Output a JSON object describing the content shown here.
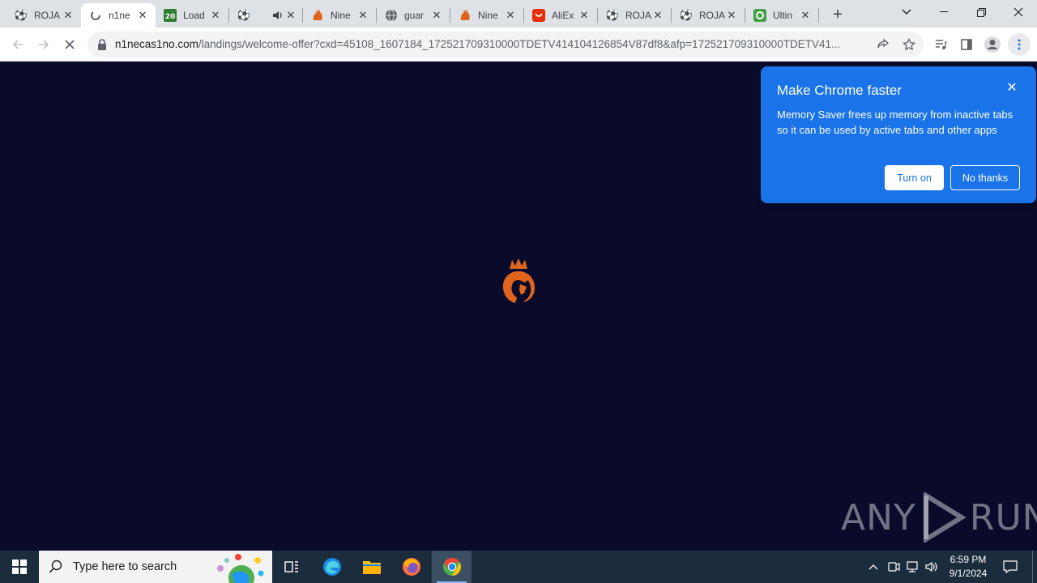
{
  "tabs": [
    {
      "title": "ROJA",
      "icon": "soccer-ball-icon"
    },
    {
      "title": "n1ne",
      "icon": "loading-spinner-icon",
      "active": true
    },
    {
      "title": "Load",
      "icon": "twenty-badge-icon"
    },
    {
      "title": "",
      "icon": "soccer-ball-icon",
      "audio": true
    },
    {
      "title": "Nine",
      "icon": "lion-icon"
    },
    {
      "title": "guar",
      "icon": "globe-icon"
    },
    {
      "title": "Nine",
      "icon": "lion-icon"
    },
    {
      "title": "AliEx",
      "icon": "aliexpress-icon"
    },
    {
      "title": "ROJA",
      "icon": "soccer-ball-icon"
    },
    {
      "title": "ROJA",
      "icon": "soccer-ball-icon"
    },
    {
      "title": "Ultin",
      "icon": "green-app-icon"
    }
  ],
  "address": {
    "host": "n1necas1no.com",
    "path": "/landings/welcome-offer?cxd=45108_1607184_172521709310000TDETV414104126854V87df8&afp=172521709310000TDETV41..."
  },
  "popup": {
    "title": "Make Chrome faster",
    "body": "Memory Saver frees up memory from inactive tabs so it can be used by active tabs and other apps",
    "turn_on": "Turn on",
    "no_thanks": "No thanks"
  },
  "watermark": {
    "left": "ANY",
    "right": "RUN"
  },
  "taskbar": {
    "search_placeholder": "Type here to search",
    "time": "6:59 PM",
    "date": "9/1/2024"
  },
  "colors": {
    "page_bg": "#0a0b2a",
    "popup_bg": "#1a73e8",
    "logo": "#e0641c",
    "taskbar": "#1b2c3d"
  }
}
